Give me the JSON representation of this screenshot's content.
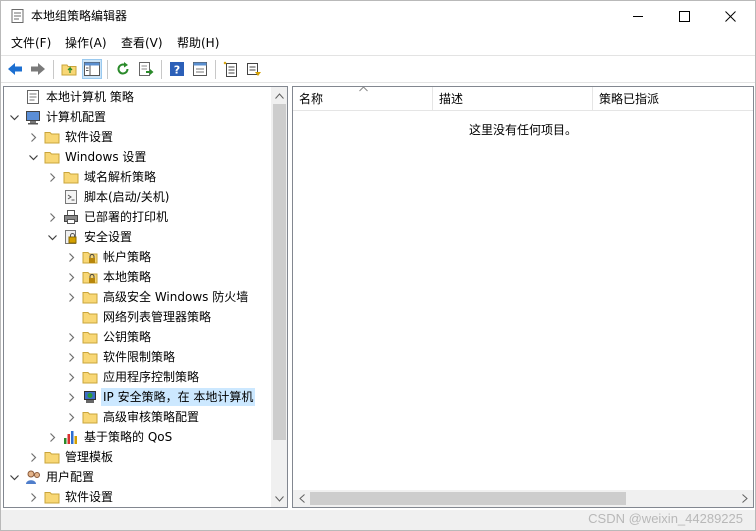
{
  "window": {
    "title": "本地组策略编辑器"
  },
  "menubar": {
    "items": [
      "文件(F)",
      "操作(A)",
      "查看(V)",
      "帮助(H)"
    ]
  },
  "toolbar": {
    "buttons": [
      "back-arrow-icon",
      "forward-arrow-icon",
      "up-folder-icon",
      "show-hide-tree-icon",
      "refresh-icon",
      "export-list-icon",
      "help-icon",
      "properties-icon",
      "new-doc-icon",
      "filter-icon"
    ]
  },
  "tree": {
    "nodes": [
      {
        "label": "本地计算机 策略",
        "icon": "policy-doc-icon",
        "level": 0,
        "expander": "none"
      },
      {
        "label": "计算机配置",
        "icon": "computer-icon",
        "level": 0,
        "expander": "expanded"
      },
      {
        "label": "软件设置",
        "icon": "folder-icon",
        "level": 1,
        "expander": "collapsed"
      },
      {
        "label": "Windows 设置",
        "icon": "folder-icon",
        "level": 1,
        "expander": "expanded"
      },
      {
        "label": "域名解析策略",
        "icon": "folder-icon",
        "level": 2,
        "expander": "collapsed"
      },
      {
        "label": "脚本(启动/关机)",
        "icon": "script-icon",
        "level": 2,
        "expander": "none"
      },
      {
        "label": "已部署的打印机",
        "icon": "printer-icon",
        "level": 2,
        "expander": "collapsed"
      },
      {
        "label": "安全设置",
        "icon": "security-icon",
        "level": 2,
        "expander": "expanded"
      },
      {
        "label": "帐户策略",
        "icon": "locked-folder-icon",
        "level": 3,
        "expander": "collapsed"
      },
      {
        "label": "本地策略",
        "icon": "locked-folder-icon",
        "level": 3,
        "expander": "collapsed"
      },
      {
        "label": "高级安全 Windows 防火墙",
        "icon": "folder-icon",
        "level": 3,
        "expander": "collapsed"
      },
      {
        "label": "网络列表管理器策略",
        "icon": "folder-icon",
        "level": 3,
        "expander": "none"
      },
      {
        "label": "公钥策略",
        "icon": "folder-icon",
        "level": 3,
        "expander": "collapsed"
      },
      {
        "label": "软件限制策略",
        "icon": "folder-icon",
        "level": 3,
        "expander": "collapsed"
      },
      {
        "label": "应用程序控制策略",
        "icon": "folder-icon",
        "level": 3,
        "expander": "collapsed"
      },
      {
        "label": "IP 安全策略，在 本地计算机",
        "icon": "ip-security-icon",
        "level": 3,
        "expander": "collapsed",
        "selected": true
      },
      {
        "label": "高级审核策略配置",
        "icon": "folder-icon",
        "level": 3,
        "expander": "collapsed"
      },
      {
        "label": "基于策略的 QoS",
        "icon": "qos-chart-icon",
        "level": 2,
        "expander": "collapsed"
      },
      {
        "label": "管理模板",
        "icon": "folder-icon",
        "level": 1,
        "expander": "collapsed"
      },
      {
        "label": "用户配置",
        "icon": "user-icon",
        "level": 0,
        "expander": "expanded"
      },
      {
        "label": "软件设置",
        "icon": "folder-icon",
        "level": 1,
        "expander": "collapsed"
      }
    ]
  },
  "list": {
    "columns": [
      "名称",
      "描述",
      "策略已指派"
    ],
    "empty_message": "这里没有任何项目。"
  },
  "watermark": "CSDN @weixin_44289225",
  "colors": {
    "selection": "#cce8ff",
    "folder": "#f8d775",
    "accent_arrow": "#1c6fd1"
  }
}
